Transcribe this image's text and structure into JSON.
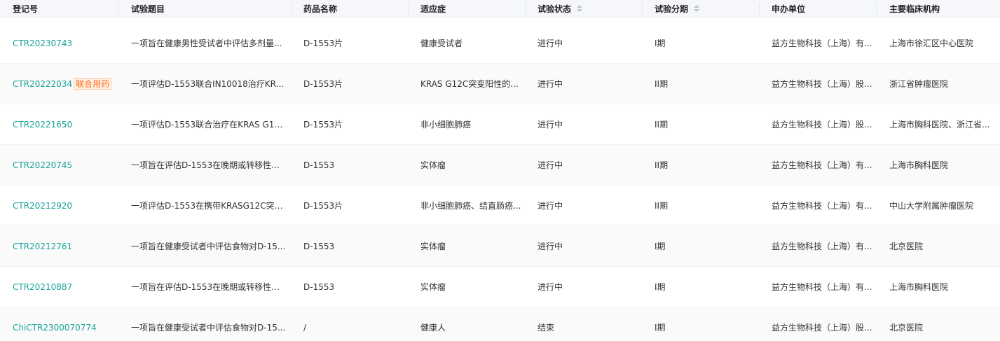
{
  "headers": {
    "reg_no": "登记号",
    "title": "试验题目",
    "drug": "药品名称",
    "indication": "适应症",
    "status": "试验状态",
    "phase": "试验分期",
    "sponsor": "申办单位",
    "site": "主要临床机构"
  },
  "rows": [
    {
      "reg_no": "CTR20230743",
      "tag": "",
      "title": "一项旨在健康男性受试者中评估多剂量...",
      "drug": "D-1553片",
      "indication": "健康受试者",
      "status": "进行中",
      "phase": "I期",
      "sponsor": "益方生物科技（上海）有...",
      "site": "上海市徐汇区中心医院"
    },
    {
      "reg_no": "CTR20222034",
      "tag": "联合用药",
      "title": "一项评估D-1553联合IN10018治疗KRA...",
      "drug": "D-1553片",
      "indication": "KRAS G12C突变阳性的...",
      "status": "进行中",
      "phase": "II期",
      "sponsor": "益方生物科技（上海）股...",
      "site": "浙江省肿瘤医院"
    },
    {
      "reg_no": "CTR20221650",
      "tag": "",
      "title": "一项评估D-1553联合治疗在KRAS G12...",
      "drug": "D-1553片",
      "indication": "非小细胞肺癌",
      "status": "进行中",
      "phase": "II期",
      "sponsor": "益方生物科技（上海）股...",
      "site": "上海市胸科医院、浙江省..."
    },
    {
      "reg_no": "CTR20220745",
      "tag": "",
      "title": "一项旨在评估D-1553在晚期或转移性实...",
      "drug": "D-1553",
      "indication": "实体瘤",
      "status": "进行中",
      "phase": "II期",
      "sponsor": "益方生物科技（上海）有...",
      "site": "上海市胸科医院"
    },
    {
      "reg_no": "CTR20212920",
      "tag": "",
      "title": "一项评估D-1553在携带KRASG12C突变...",
      "drug": "D-1553片",
      "indication": "非小细胞肺癌、结直肠癌...",
      "status": "进行中",
      "phase": "II期",
      "sponsor": "益方生物科技（上海）有...",
      "site": "中山大学附属肿瘤医院"
    },
    {
      "reg_no": "CTR20212761",
      "tag": "",
      "title": "一项旨在健康受试者中评估食物对D-15...",
      "drug": "D-1553",
      "indication": "实体瘤",
      "status": "进行中",
      "phase": "I期",
      "sponsor": "益方生物科技（上海）有...",
      "site": "北京医院"
    },
    {
      "reg_no": "CTR20210887",
      "tag": "",
      "title": "一项旨在评估D-1553在晚期或转移性实...",
      "drug": "D-1553",
      "indication": "实体瘤",
      "status": "进行中",
      "phase": "I期",
      "sponsor": "益方生物科技（上海）有...",
      "site": "上海市胸科医院"
    },
    {
      "reg_no": "ChiCTR2300070774",
      "tag": "",
      "title": "一项旨在健康受试者中评估食物对D-15...",
      "drug": "/",
      "indication": "健康人",
      "status": "结束",
      "phase": "I期",
      "sponsor": "益方生物科技（上海）股...",
      "site": "北京医院"
    }
  ],
  "colors": {
    "link": "#1aa39a",
    "tag_text": "#ff6b1a",
    "tag_bg": "#fff1e6",
    "header_bg": "#f5f7fa"
  }
}
